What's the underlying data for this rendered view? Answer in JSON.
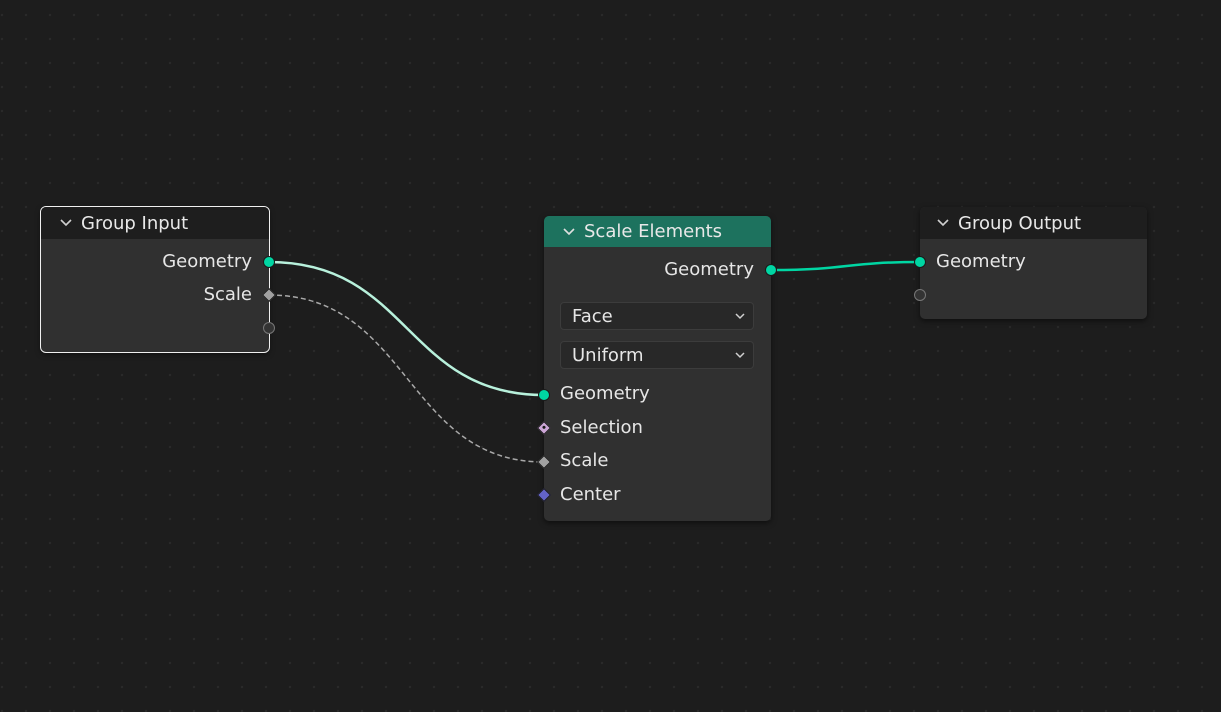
{
  "colors": {
    "background": "#1d1d1d",
    "node_body": "#303030",
    "node_header": "#1e1e1e",
    "geometry_header": "#1d725e",
    "geometry_socket": "#00d6a3",
    "float_socket": "#a1a1a1",
    "boolean_socket": "#cca6d6",
    "vector_socket": "#6363c7",
    "selected_link": "#b8f1dc"
  },
  "nodes": {
    "group_input": {
      "title": "Group Input",
      "outputs": [
        "Geometry",
        "Scale"
      ]
    },
    "scale_elements": {
      "title": "Scale Elements",
      "outputs": [
        "Geometry"
      ],
      "domain": "Face",
      "scale_mode": "Uniform",
      "inputs": [
        "Geometry",
        "Selection",
        "Scale",
        "Center"
      ]
    },
    "group_output": {
      "title": "Group Output",
      "inputs": [
        "Geometry"
      ]
    }
  },
  "icons": {
    "collapse": "chevron-down-icon",
    "dropdown": "chevron-down-icon",
    "geometry_socket": "circle-socket-icon",
    "field_socket": "diamond-socket-icon",
    "empty_socket": "empty-socket-icon"
  }
}
